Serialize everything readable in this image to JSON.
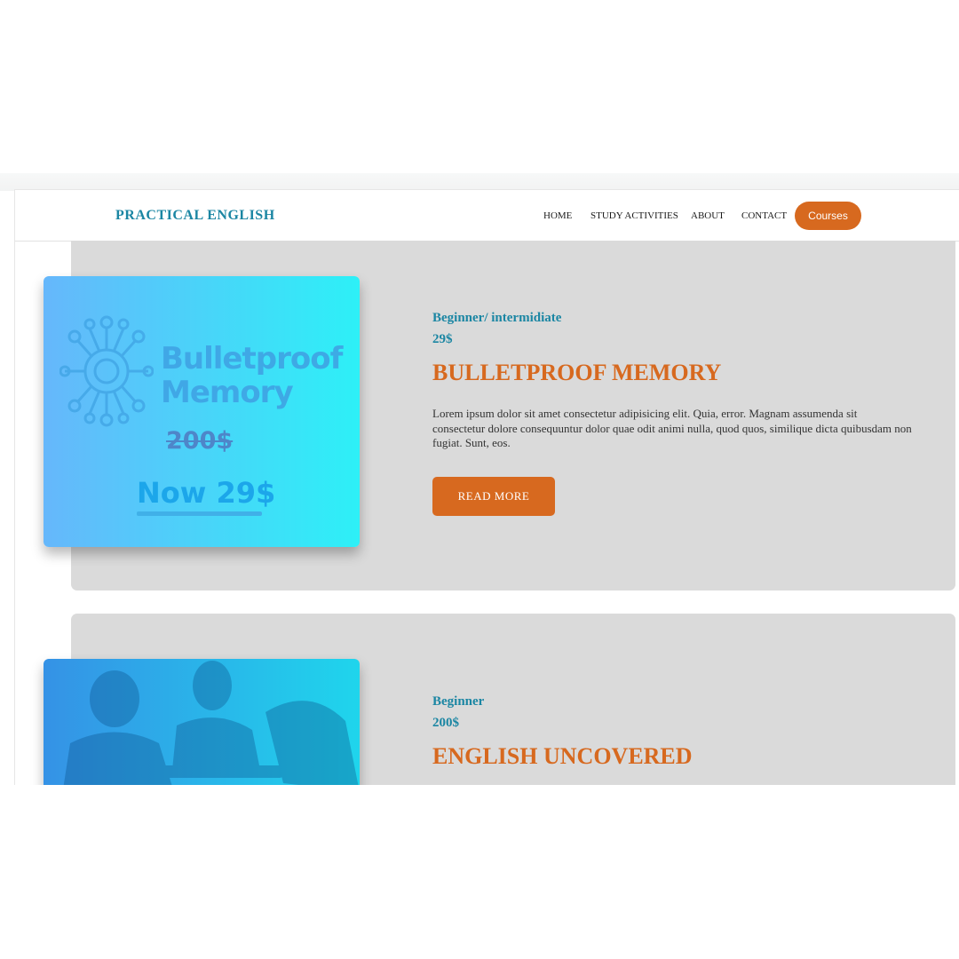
{
  "brand": "PRACTICAL ENGLISH",
  "nav": {
    "home": "HOME",
    "study": "STUDY ACTIVITIES",
    "about": "ABOUT",
    "contact": "CONTACT",
    "cta": "Courses"
  },
  "courses": [
    {
      "level": "Beginner/ intermidiate",
      "price": "29$",
      "title": "BULLETPROOF MEMORY",
      "description": "Lorem ipsum dolor sit amet consectetur adipisicing elit. Quia, error. Magnam assumenda sit consectetur dolore consequuntur dolor quae odit animi nulla, quod quos, similique dicta quibusdam non fugiat. Sunt, eos.",
      "button": "READ MORE",
      "image": {
        "brand_line1": "Bulletproof",
        "brand_line2": "Memory",
        "old_price": "200$",
        "new_price": "Now 29$",
        "icon": "neural-network-icon"
      }
    },
    {
      "level": "Beginner",
      "price": "200$",
      "title": "ENGLISH UNCOVERED",
      "image": {
        "icon": "people-studying-photo"
      }
    }
  ],
  "colors": {
    "accent_orange": "#d7691f",
    "accent_teal": "#1b86a3",
    "card_bg": "#dadada"
  }
}
